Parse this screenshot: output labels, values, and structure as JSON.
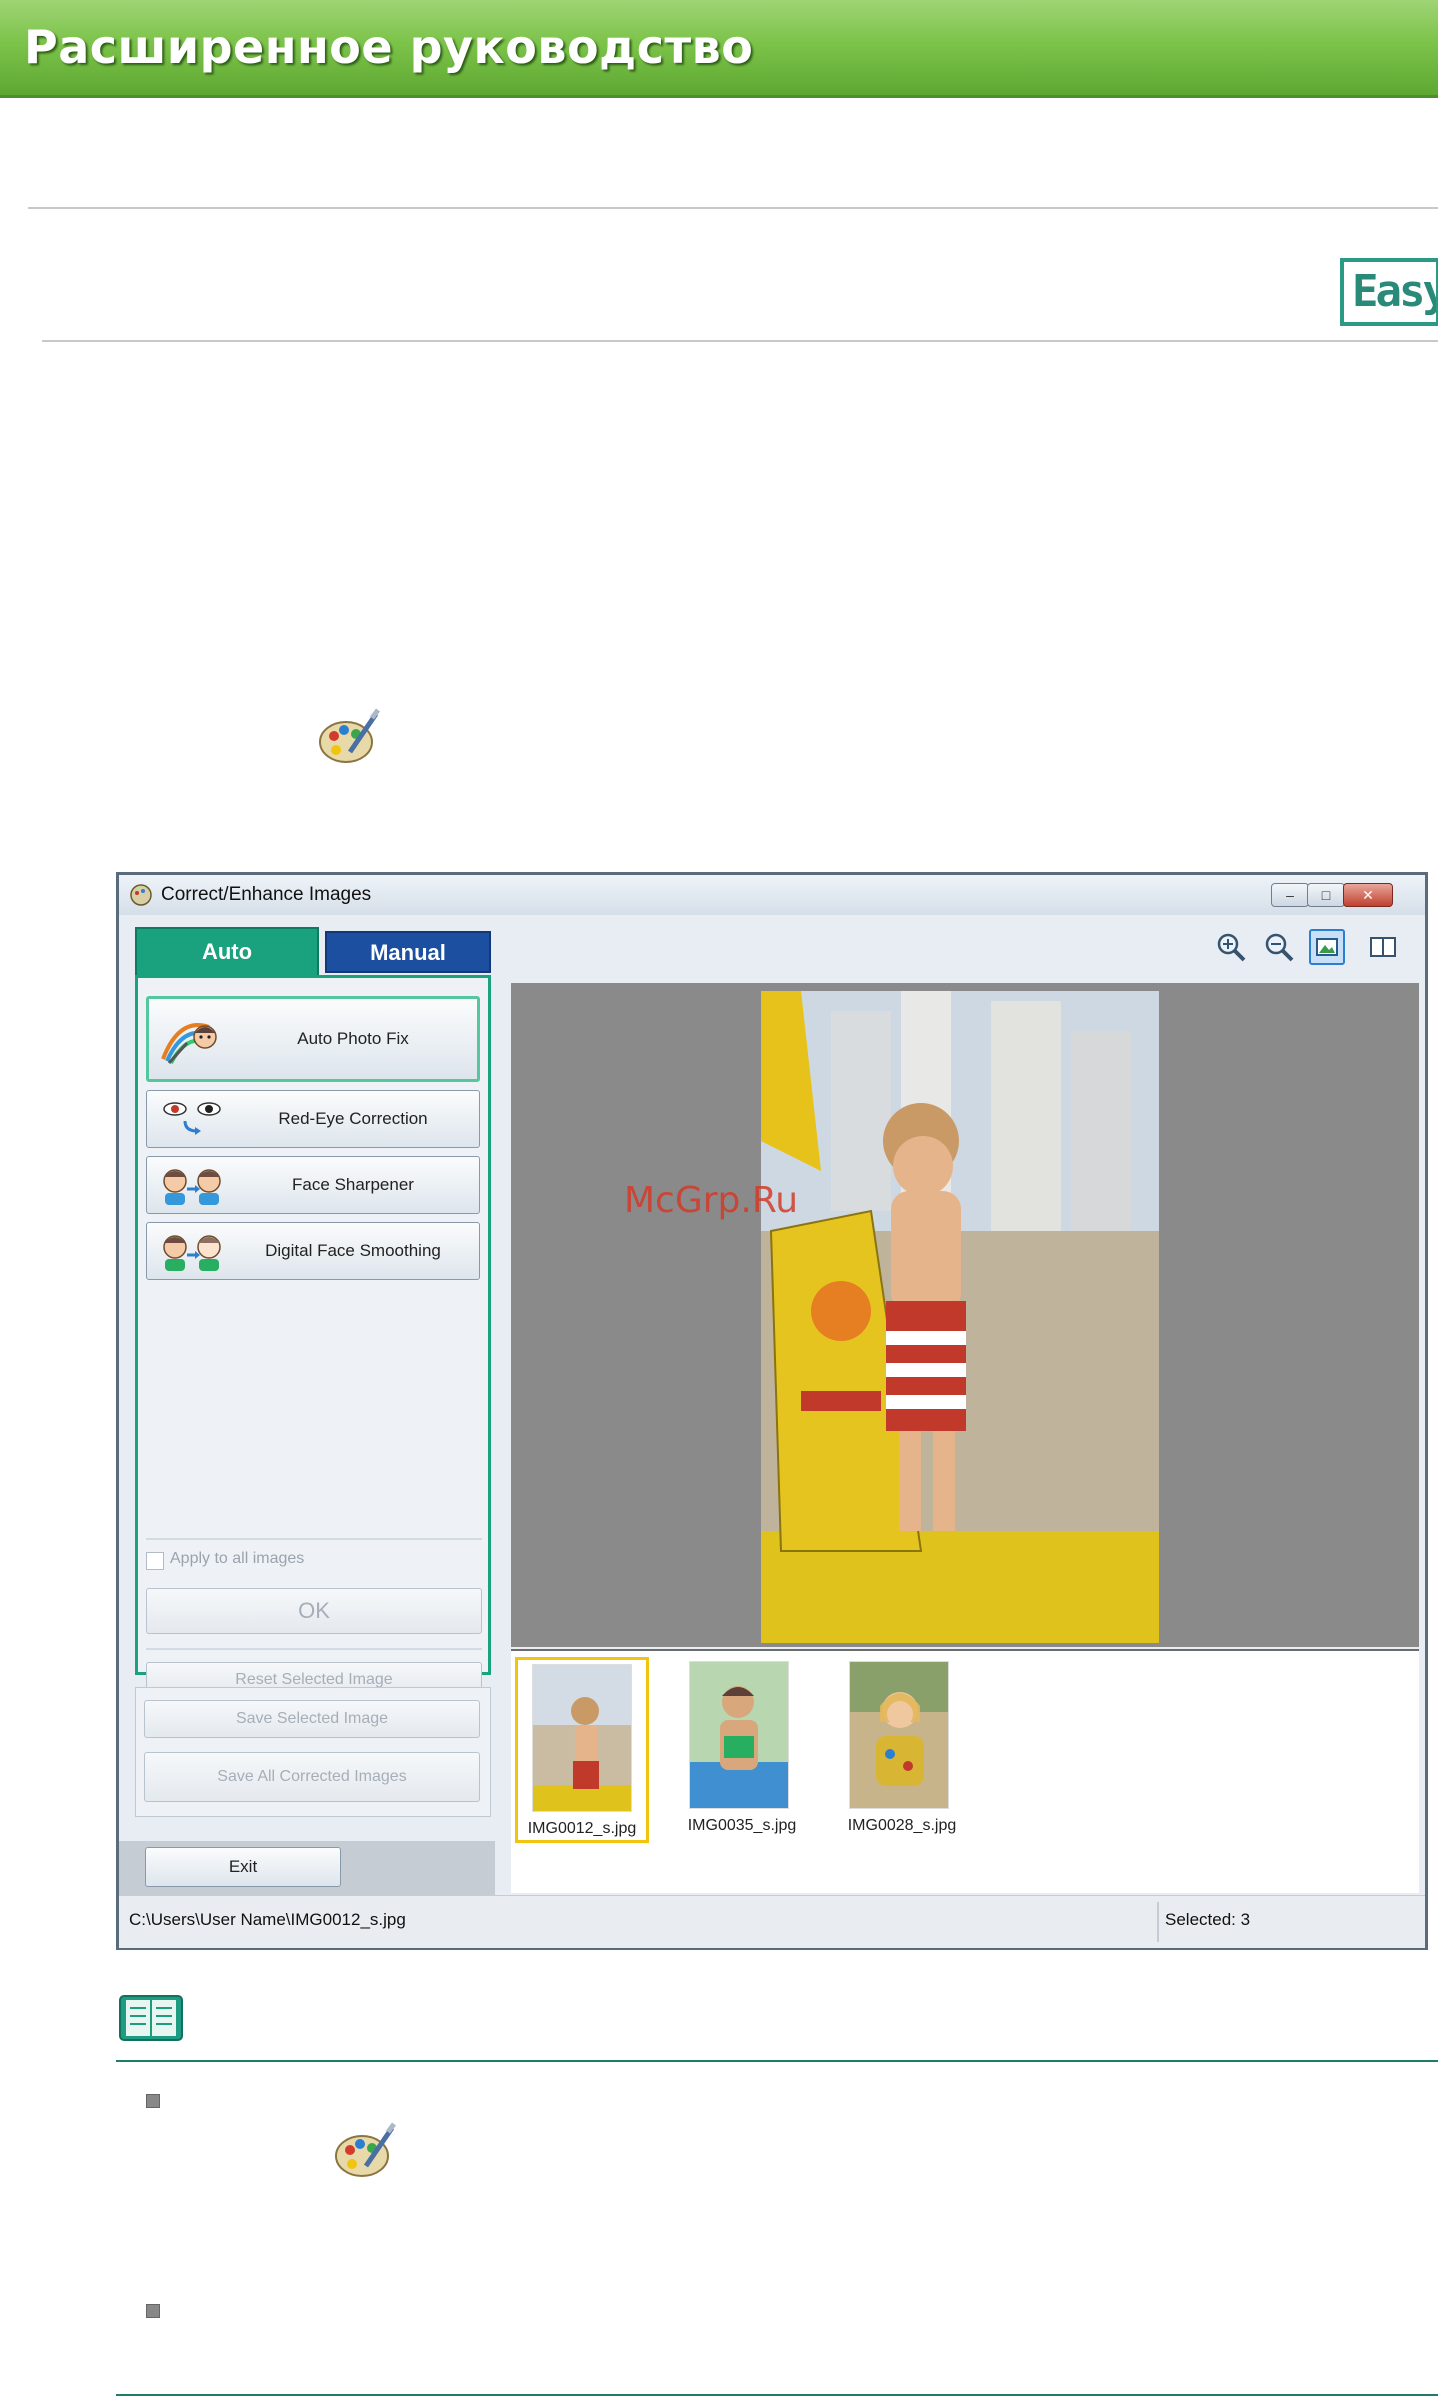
{
  "header": {
    "title": "Расширенное руководство"
  },
  "badge": {
    "label": "Easy"
  },
  "watermark": {
    "text": "McGrp.Ru"
  },
  "window": {
    "title": "Correct/Enhance Images",
    "controls": {
      "minimize": "–",
      "maximize": "□",
      "close": "✕"
    },
    "tabs": {
      "auto": "Auto",
      "manual": "Manual"
    },
    "functions": [
      {
        "label": "Auto Photo Fix",
        "icon": "auto-photo-fix-icon"
      },
      {
        "label": "Red-Eye Correction",
        "icon": "red-eye-icon"
      },
      {
        "label": "Face Sharpener",
        "icon": "face-sharpener-icon"
      },
      {
        "label": "Digital Face Smoothing",
        "icon": "face-smoothing-icon"
      }
    ],
    "apply_all": "Apply to all images",
    "ok": "OK",
    "reset": "Reset Selected Image",
    "save_selected": "Save Selected Image",
    "save_all": "Save All Corrected Images",
    "exit": "Exit",
    "thumbnails": [
      {
        "name": "IMG0012_s.jpg",
        "selected": true
      },
      {
        "name": "IMG0035_s.jpg",
        "selected": false
      },
      {
        "name": "IMG0028_s.jpg",
        "selected": false
      }
    ],
    "status": {
      "path": "C:\\Users\\User Name\\IMG0012_s.jpg",
      "selected": "Selected: 3"
    }
  },
  "colors": {
    "banner": "#7cc34a",
    "accent": "#1aa17e",
    "manual_tab": "#1d4fa0",
    "watermark": "#d33b2a"
  }
}
